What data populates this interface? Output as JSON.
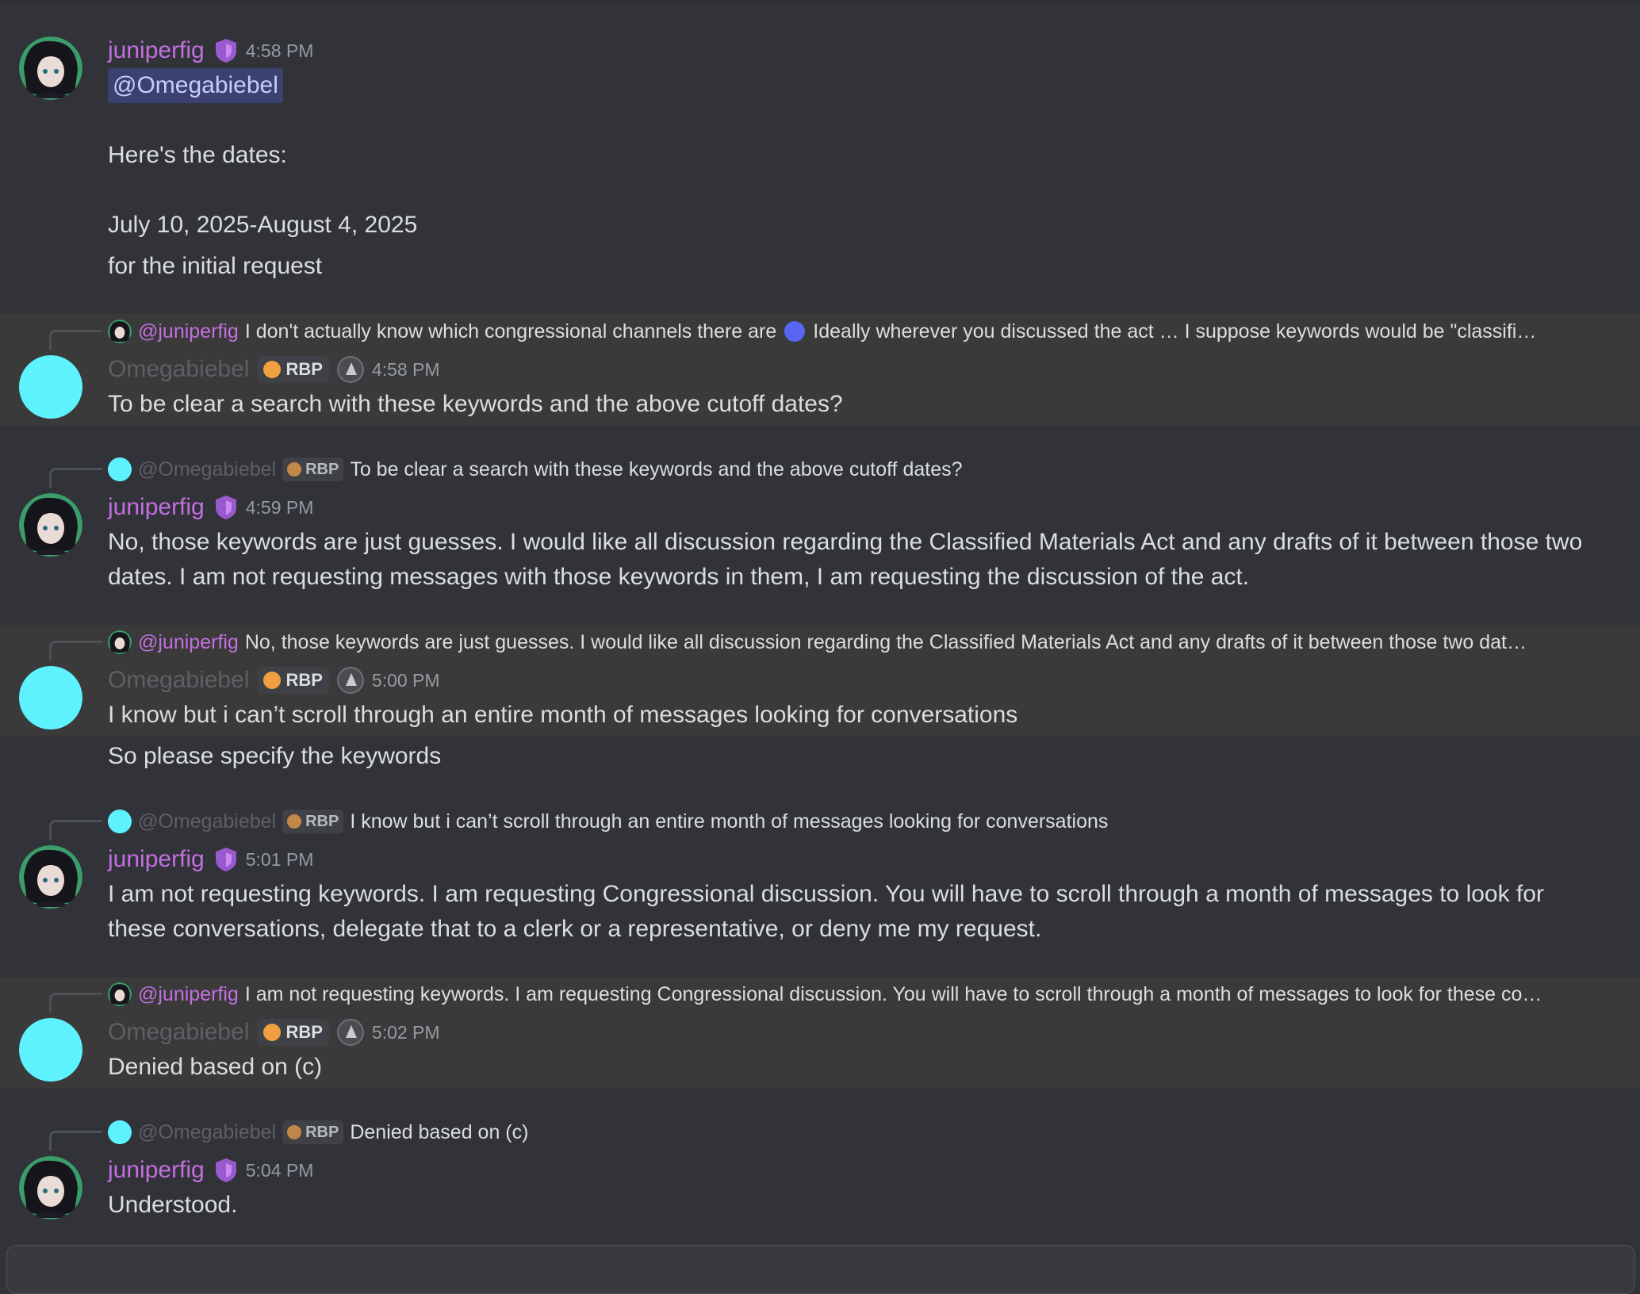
{
  "messages": [
    {
      "author": "juniperfig",
      "time": "4:58 PM",
      "mention": "@Omegabiebel",
      "lines": [
        "Here's the dates:",
        "July 10, 2025-August 4, 2025",
        "for the initial request"
      ]
    },
    {
      "reply": {
        "name": "@juniperfig",
        "text": "I don't actually know which congressional channels there are",
        "text2": "Ideally wherever you discussed the act … I suppose keywords would be \"classifi…"
      },
      "author": "Omegabiebel",
      "tag": "RBP",
      "time": "4:58 PM",
      "text": "To be clear a search with these keywords and the above cutoff dates?"
    },
    {
      "reply": {
        "name": "@Omegabiebel",
        "tag": "RBP",
        "text": "To be clear a search with these keywords and the above cutoff dates?"
      },
      "author": "juniperfig",
      "time": "4:59 PM",
      "text": "No, those keywords are just guesses. I would like all discussion regarding the Classified Materials Act and any drafts of it between those two dates. I am not requesting messages with those keywords in them, I am requesting the discussion of the act."
    },
    {
      "reply": {
        "name": "@juniperfig",
        "text": "No, those keywords are just guesses. I would like all discussion regarding the Classified Materials Act and any drafts of it between those two dat…"
      },
      "author": "Omegabiebel",
      "tag": "RBP",
      "time": "5:00 PM",
      "text": "I know but i can’t scroll through an entire month of messages looking for conversations",
      "followup": "So please specify the keywords"
    },
    {
      "reply": {
        "name": "@Omegabiebel",
        "tag": "RBP",
        "text": "I know but i can’t scroll through an entire month of messages looking for conversations"
      },
      "author": "juniperfig",
      "time": "5:01 PM",
      "text": "I am not requesting keywords. I am requesting Congressional discussion. You will have to scroll through a month of messages to look for these conversations, delegate that to a clerk or a representative, or deny me my request."
    },
    {
      "reply": {
        "name": "@juniperfig",
        "text": "I am not requesting keywords. I am requesting Congressional discussion. You will have to scroll through a month of messages to look for these co…"
      },
      "author": "Omegabiebel",
      "tag": "RBP",
      "time": "5:02 PM",
      "text": "Denied based on (c)"
    },
    {
      "reply": {
        "name": "@Omegabiebel",
        "tag": "RBP",
        "text": "Denied based on (c)"
      },
      "author": "juniperfig",
      "time": "5:04 PM",
      "text": "Understood."
    }
  ],
  "colors": {
    "background": "#313338",
    "highlight": "#3a3a3a",
    "juniperfig": "#c36fe0",
    "omegabiebel_name": "#5e5f66",
    "omegabiebel_avatar": "#5ef2ff",
    "mention_bg": "#3c4270"
  },
  "icons": {
    "shield": "shield-icon",
    "badge": "capitol-badge-icon",
    "tag_emoji": "flame-ball-icon",
    "eye_emoji": "eyes-emoji-icon"
  }
}
